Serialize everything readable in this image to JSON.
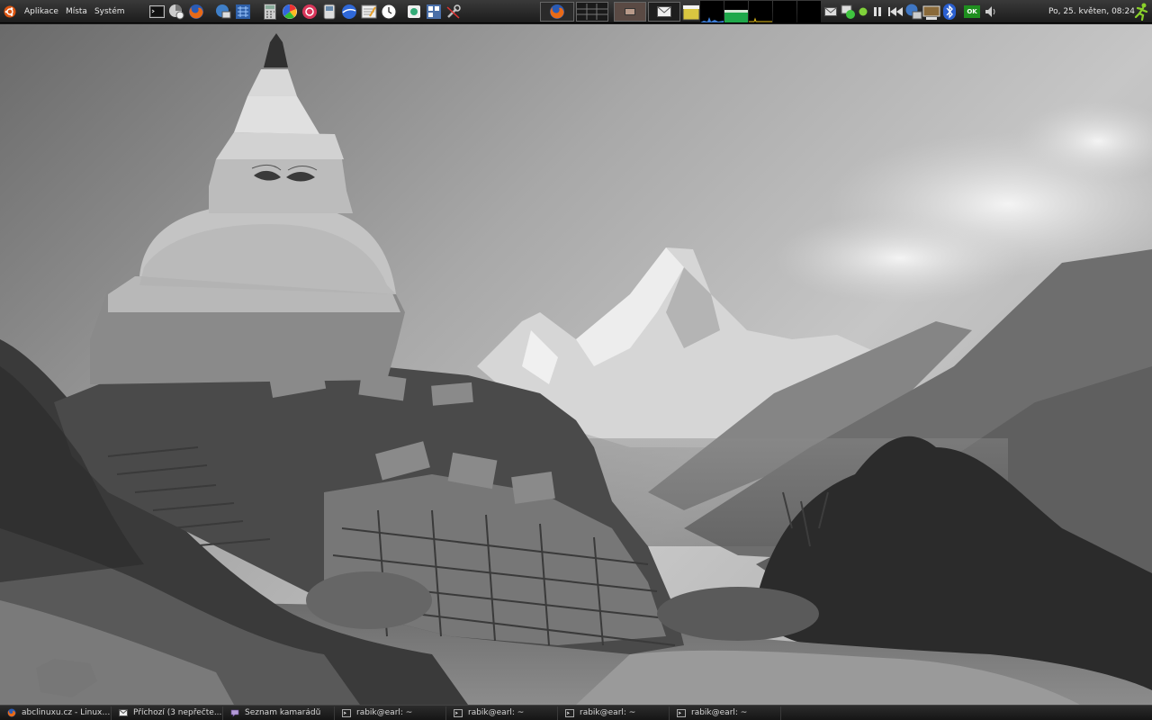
{
  "top_panel": {
    "menus": [
      {
        "label": "Aplikace"
      },
      {
        "label": "Místa"
      },
      {
        "label": "Systém"
      }
    ],
    "launchers": [
      "terminal-icon",
      "disk-usage-icon",
      "firefox-icon",
      "network-icon",
      "grid-app-icon",
      "calculator-icon",
      "picasa-icon",
      "stop-app-icon",
      "phone-icon",
      "globe-icon",
      "text-editor-icon",
      "clock-app-icon",
      "camera-icon",
      "screenshot-icon",
      "tools-icon"
    ],
    "tray": {
      "ok_label": "OK",
      "clock": "Po, 25. květen, 08:24"
    }
  },
  "taskbar": {
    "items": [
      {
        "label": "abclinuxu.cz - Linux ...",
        "icon": "firefox-icon"
      },
      {
        "label": "Příchozí (3 nepřečte...",
        "icon": "mail-icon"
      },
      {
        "label": "Seznam kamarádů",
        "icon": "pidgin-icon"
      },
      {
        "label": "rabik@earl: ~",
        "icon": "terminal-icon"
      },
      {
        "label": "rabik@earl: ~",
        "icon": "terminal-icon"
      },
      {
        "label": "rabik@earl: ~",
        "icon": "terminal-icon"
      },
      {
        "label": "rabik@earl: ~",
        "icon": "terminal-icon"
      }
    ]
  },
  "colors": {
    "panel": "#1c1c1c",
    "ok_green": "#1f8f1f",
    "firefox": "#e86a17"
  }
}
